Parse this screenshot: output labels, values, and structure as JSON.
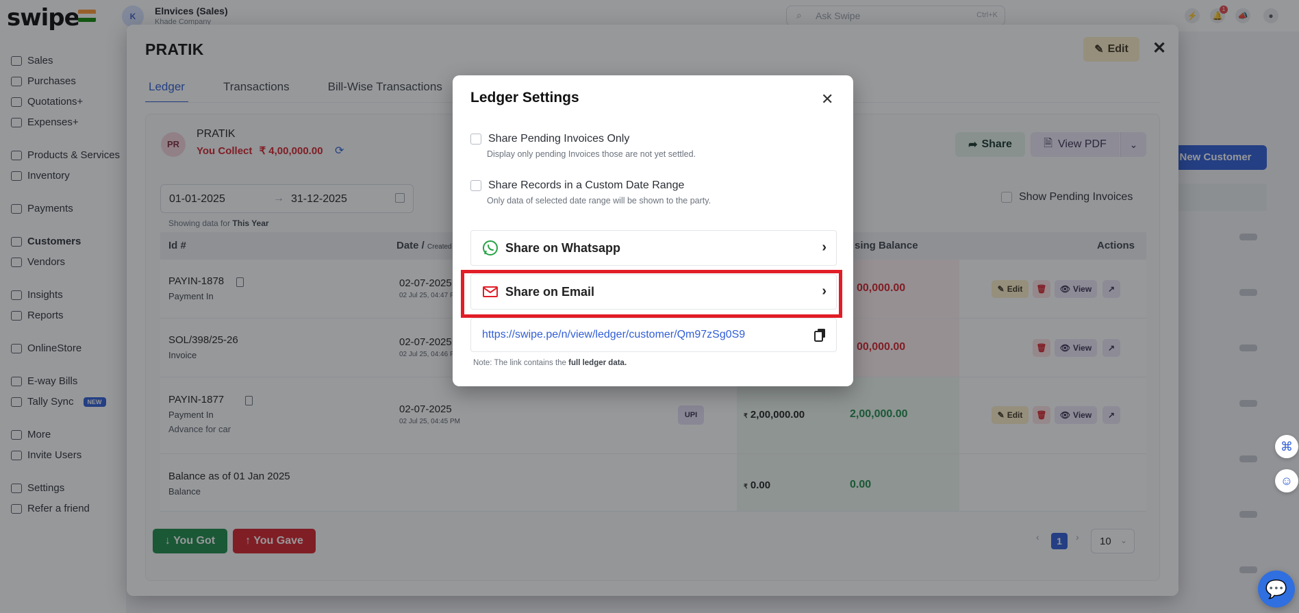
{
  "app": {
    "logo": "swipe",
    "company_initial": "K",
    "company_name": "Elnvices (Sales)",
    "company_sub": "Khade Company",
    "search_placeholder": "Ask Swipe",
    "search_shortcut": "Ctrl+K",
    "notification_count": "1"
  },
  "sidebar": {
    "items": [
      {
        "label": "Sales"
      },
      {
        "label": "Purchases"
      },
      {
        "label": "Quotations+"
      },
      {
        "label": "Expenses+"
      },
      {
        "label": "Products & Services"
      },
      {
        "label": "Inventory"
      },
      {
        "label": "Payments"
      },
      {
        "label": "Customers"
      },
      {
        "label": "Vendors"
      },
      {
        "label": "Insights"
      },
      {
        "label": "Reports"
      },
      {
        "label": "OnlineStore"
      },
      {
        "label": "E-way Bills"
      },
      {
        "label": "Tally Sync",
        "badge": "NEW"
      },
      {
        "label": "More"
      },
      {
        "label": "Invite Users"
      },
      {
        "label": "Settings"
      },
      {
        "label": "Refer a friend"
      }
    ]
  },
  "background": {
    "new_customer_button": "New Customer"
  },
  "drawer": {
    "title": "PRATIK",
    "edit_label": "Edit",
    "tabs": [
      "Ledger",
      "Transactions",
      "Bill-Wise Transactions"
    ],
    "party": {
      "initials": "PR",
      "name": "PRATIK",
      "collect_label": "You Collect",
      "collect_amount": "₹ 4,00,000.00"
    },
    "share_label": "Share",
    "view_pdf_label": "View PDF",
    "date_from": "01-01-2025",
    "date_to": "31-12-2025",
    "showing_prefix": "Showing data for",
    "showing_period": "This Year",
    "show_pending_label": "Show Pending Invoices",
    "columns": {
      "id": "Id #",
      "date": "Date /",
      "date_sub": "Created",
      "closing": "sing Balance",
      "actions": "Actions"
    },
    "rows": [
      {
        "id": "PAYIN-1878",
        "type": "Payment In",
        "date": "02-07-2025",
        "time": "02 Jul 25, 04:47 P",
        "closing": "00,000.00"
      },
      {
        "id": "SOL/398/25-26",
        "type": "Invoice",
        "date": "02-07-2025",
        "time": "02 Jul 25, 04:46 P",
        "closing": "00,000.00"
      },
      {
        "id": "PAYIN-1877",
        "type": "Payment In",
        "note": "Advance for car",
        "date": "02-07-2025",
        "time": "02 Jul 25, 04:45 PM",
        "mode": "UPI",
        "amount": "2,00,000.00",
        "closing": "2,00,000.00"
      },
      {
        "id": "Balance as of 01 Jan 2025",
        "type": "Balance",
        "amount": "0.00",
        "closing": "0.00"
      }
    ],
    "row_actions": {
      "edit": "Edit",
      "view": "View"
    },
    "you_got_label": "You Got",
    "you_gave_label": "You Gave",
    "page_current": "1",
    "page_size": "10"
  },
  "settings": {
    "title": "Ledger Settings",
    "options": [
      {
        "label": "Share Pending Invoices Only",
        "description": "Display only pending Invoices those are not yet settled."
      },
      {
        "label": "Share Records in a Custom Date Range",
        "description": "Only data of selected date range will be shown to the party."
      }
    ],
    "share_whatsapp": "Share on Whatsapp",
    "share_email": "Share on Email",
    "link": "https://swipe.pe/n/view/ledger/customer/Qm97zSg0S9",
    "note_prefix": "Note: The link contains the",
    "note_bold": "full ledger data."
  },
  "colors": {
    "primary": "#2f5dd6",
    "danger": "#d6222b",
    "success": "#1c8a49",
    "highlight": "#e11d27"
  }
}
